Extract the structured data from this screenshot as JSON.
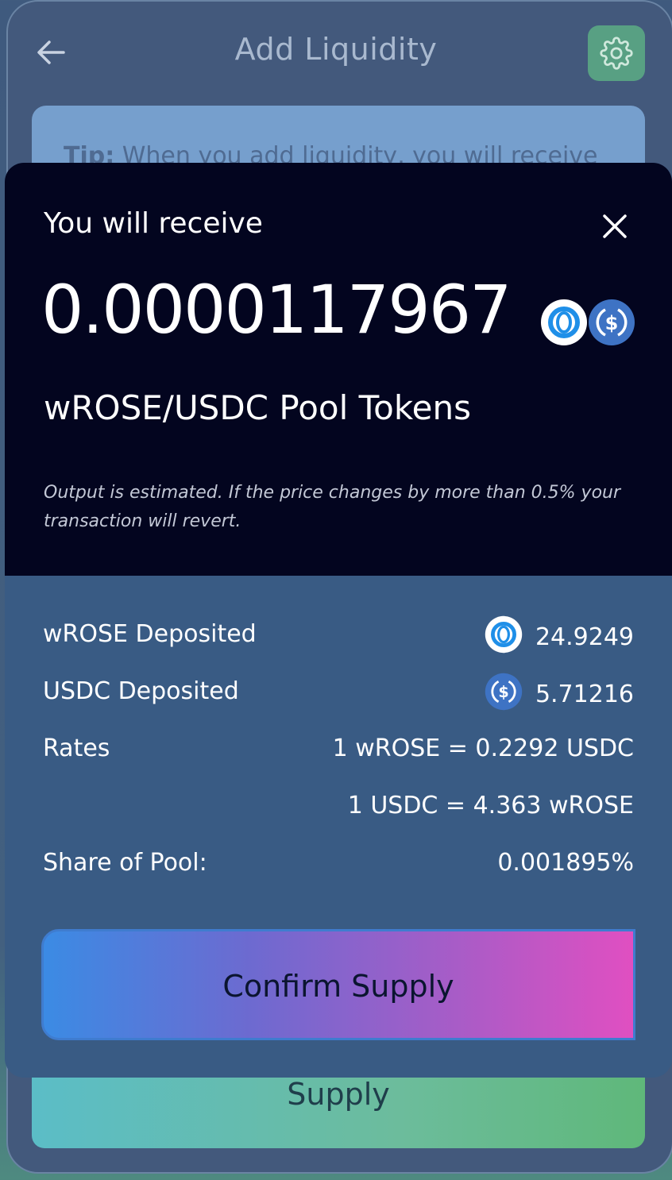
{
  "background": {
    "title": "Add Liquidity",
    "tip_prefix": "Tip:",
    "tip_text": " When you add liquidity, you will receive",
    "supply_label": "Supply"
  },
  "modal": {
    "title": "You will receive",
    "amount": "0.0000117967",
    "pool_tokens": "wROSE/USDC Pool Tokens",
    "estimate_note": "Output is estimated. If the price changes by more than 0.5% your transaction will revert.",
    "rows": [
      {
        "label": "wROSE Deposited",
        "value": "24.9249",
        "icon": "wrose-icon"
      },
      {
        "label": "USDC Deposited",
        "value": "5.71216",
        "icon": "usdc-icon"
      },
      {
        "label": "Rates",
        "value": "1 wROSE = 0.2292 USDC"
      },
      {
        "label": "",
        "value": "1 USDC = 4.363 wROSE"
      },
      {
        "label": "Share of Pool:",
        "value": "0.001895%"
      }
    ],
    "confirm_label": "Confirm Supply"
  },
  "colors": {
    "modal_header_bg": "#03051f",
    "modal_body_bg": "#395b84",
    "settings_accent": "#58a083",
    "confirm_gradient_start": "#3b8be4",
    "confirm_gradient_end": "#e04fc1"
  }
}
